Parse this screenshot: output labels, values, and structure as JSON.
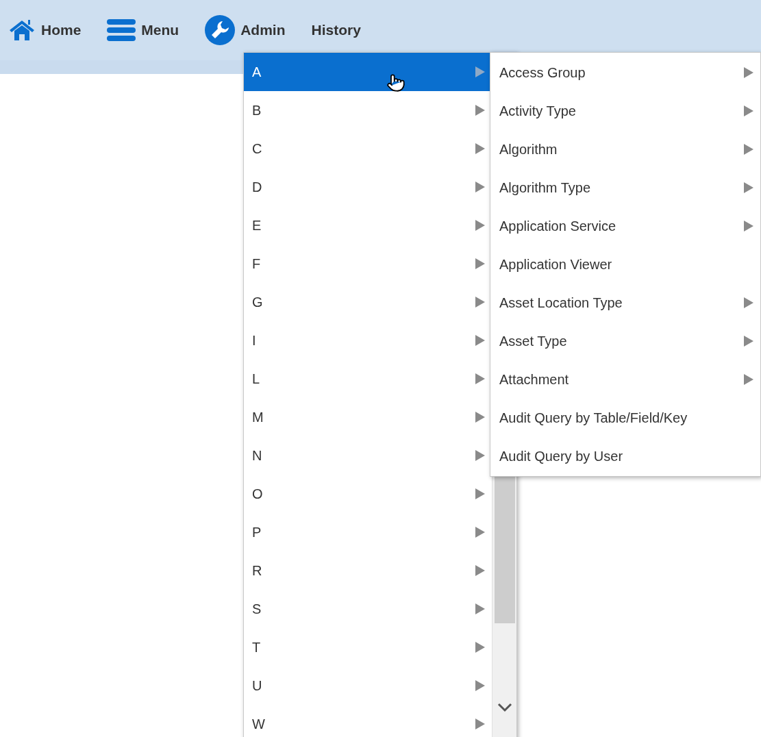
{
  "nav": [
    {
      "kind": "home",
      "label": "Home"
    },
    {
      "kind": "menu",
      "label": "Menu"
    },
    {
      "kind": "admin",
      "label": "Admin"
    },
    {
      "kind": "plain",
      "label": "History"
    }
  ],
  "letter_menu": [
    {
      "label": "A",
      "selected": true
    },
    {
      "label": "B",
      "selected": false
    },
    {
      "label": "C",
      "selected": false
    },
    {
      "label": "D",
      "selected": false
    },
    {
      "label": "E",
      "selected": false
    },
    {
      "label": "F",
      "selected": false
    },
    {
      "label": "G",
      "selected": false
    },
    {
      "label": "I",
      "selected": false
    },
    {
      "label": "L",
      "selected": false
    },
    {
      "label": "M",
      "selected": false
    },
    {
      "label": "N",
      "selected": false
    },
    {
      "label": "O",
      "selected": false
    },
    {
      "label": "P",
      "selected": false
    },
    {
      "label": "R",
      "selected": false
    },
    {
      "label": "S",
      "selected": false
    },
    {
      "label": "T",
      "selected": false
    },
    {
      "label": "U",
      "selected": false
    },
    {
      "label": "W",
      "selected": false
    }
  ],
  "submenu": [
    {
      "label": "Access Group",
      "has_submenu": true
    },
    {
      "label": "Activity Type",
      "has_submenu": true
    },
    {
      "label": "Algorithm",
      "has_submenu": true
    },
    {
      "label": "Algorithm Type",
      "has_submenu": true
    },
    {
      "label": "Application Service",
      "has_submenu": true
    },
    {
      "label": "Application Viewer",
      "has_submenu": false
    },
    {
      "label": "Asset Location Type",
      "has_submenu": true
    },
    {
      "label": "Asset Type",
      "has_submenu": true
    },
    {
      "label": "Attachment",
      "has_submenu": true
    },
    {
      "label": "Audit Query by Table/Field/Key",
      "has_submenu": false
    },
    {
      "label": "Audit Query by User",
      "has_submenu": false
    }
  ]
}
